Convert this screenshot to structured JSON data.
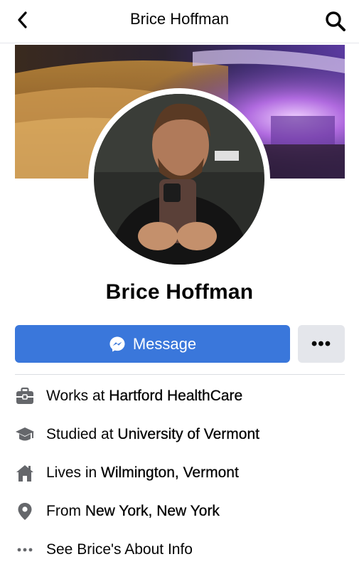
{
  "header": {
    "title": "Brice Hoffman"
  },
  "profile": {
    "name": "Brice Hoffman"
  },
  "actions": {
    "message_label": "Message",
    "more_label": "•••"
  },
  "info": [
    {
      "icon": "briefcase-icon",
      "prefix": "Works at ",
      "value": "Hartford HealthCare"
    },
    {
      "icon": "graduation-cap-icon",
      "prefix": "Studied at ",
      "value": "University of Vermont"
    },
    {
      "icon": "house-icon",
      "prefix": "Lives in ",
      "value": "Wilmington, Vermont"
    },
    {
      "icon": "location-pin-icon",
      "prefix": "From ",
      "value": "New York, New York"
    },
    {
      "icon": "more-dots-icon",
      "prefix": "See Brice's About Info",
      "value": ""
    }
  ],
  "colors": {
    "accent": "#3a77db",
    "secondary_button": "#e4e6eb",
    "icon_gray": "#65676b"
  }
}
